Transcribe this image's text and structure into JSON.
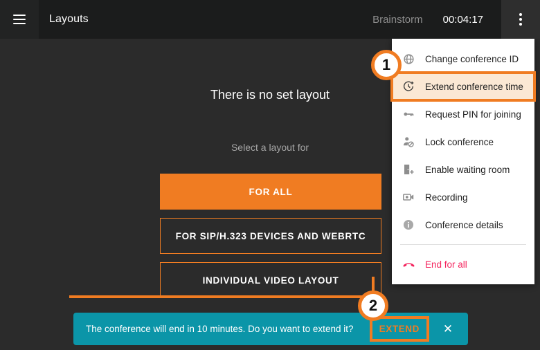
{
  "header": {
    "menu_icon": "hamburger-icon",
    "title": "Layouts",
    "conference_name": "Brainstorm",
    "timer": "00:04:17",
    "kebab_icon": "more-vertical-icon"
  },
  "main": {
    "no_layout_title": "There is no set layout",
    "select_layout_text": "Select a layout for",
    "buttons": [
      {
        "label": "FOR ALL",
        "style": "primary"
      },
      {
        "label": "FOR SIP/H.323 DEVICES AND WEBRTC",
        "style": "outline"
      },
      {
        "label": "INDIVIDUAL VIDEO LAYOUT",
        "style": "outline"
      }
    ]
  },
  "dropdown": {
    "items": [
      {
        "label": "Change conference ID",
        "icon": "globe-icon",
        "highlighted": false
      },
      {
        "label": "Extend conference time",
        "icon": "clock-plus-icon",
        "highlighted": true
      },
      {
        "label": "Request PIN for joining",
        "icon": "key-icon",
        "highlighted": false
      },
      {
        "label": "Lock conference",
        "icon": "person-blocked-icon",
        "highlighted": false
      },
      {
        "label": "Enable waiting room",
        "icon": "door-plus-icon",
        "highlighted": false
      },
      {
        "label": "Recording",
        "icon": "video-camera-icon",
        "highlighted": false
      },
      {
        "label": "Conference details",
        "icon": "info-icon",
        "highlighted": false
      }
    ],
    "end_item": {
      "label": "End for all",
      "icon": "phone-hangup-icon"
    }
  },
  "snackbar": {
    "message": "The conference will end in 10 minutes. Do you want to extend it?",
    "extend_label": "EXTEND",
    "close_icon": "close-icon"
  },
  "annotations": {
    "badge_1": "1",
    "badge_2": "2"
  },
  "colors": {
    "accent_orange": "#f07c22",
    "snackbar_teal": "#0b95a8",
    "danger_red": "#f4245e",
    "page_bg": "#2b2b2b",
    "header_bg": "#1b1c1c",
    "highlight_bg": "#fbe8d4"
  }
}
